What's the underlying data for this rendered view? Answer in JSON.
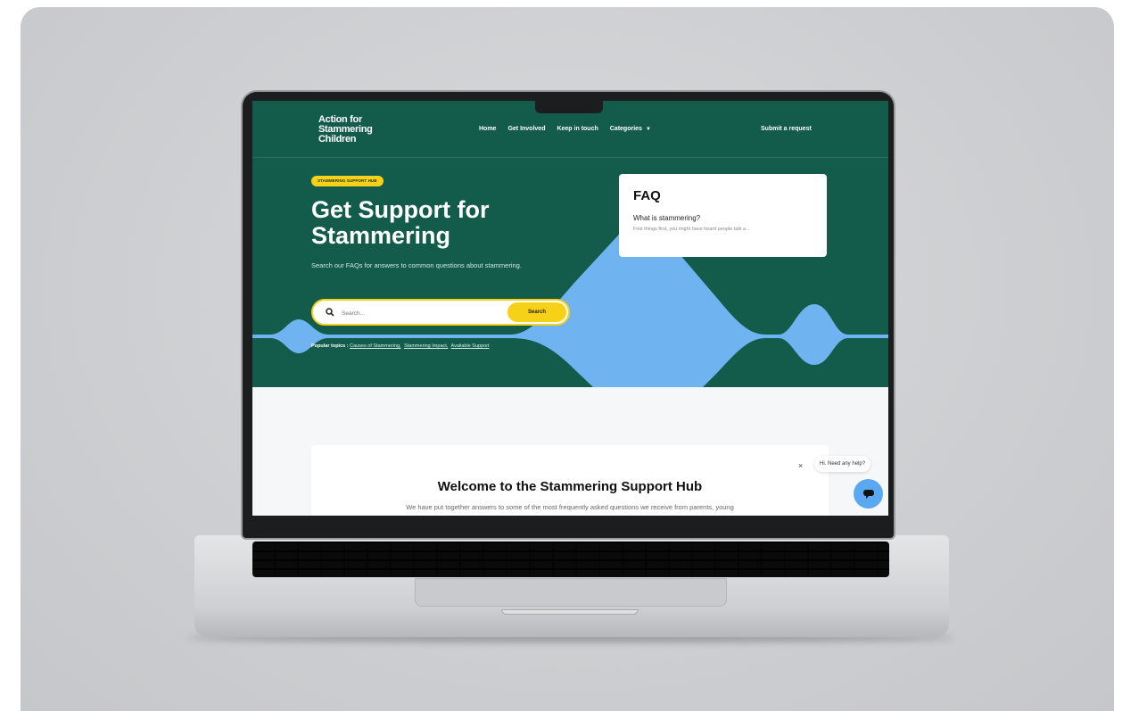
{
  "site": {
    "logo_lines": [
      "Action for",
      "Stammering",
      "Children"
    ]
  },
  "nav": {
    "items": [
      {
        "label": "Home"
      },
      {
        "label": "Get Involved"
      },
      {
        "label": "Keep in touch"
      },
      {
        "label": "Categories"
      }
    ],
    "submit_request": "Submit a request"
  },
  "hero": {
    "badge": "STAMMERING SUPPORT HUB",
    "title_line1": "Get Support for",
    "title_line2": "Stammering",
    "subtitle": "Search our FAQs for answers to common questions about stammering.",
    "search": {
      "placeholder": "Search...",
      "button": "Search"
    },
    "popular": {
      "label": "Popular topics :",
      "topics": [
        "Causes of Stammering,",
        "Stammering Impact,",
        "Available Support"
      ]
    }
  },
  "faq_card": {
    "title": "FAQ",
    "question": "What is stammering?",
    "answer_preview": "First things first, you might have heard people talk a..."
  },
  "welcome": {
    "title": "Welcome to the Stammering Support Hub",
    "text": "We have put together answers to some of the most frequently asked questions we receive from parents, young"
  },
  "chat": {
    "prompt": "Hi. Need any help?",
    "close_glyph": "×"
  },
  "colors": {
    "brand_green": "#135c4b",
    "accent_yellow": "#f7d117",
    "wave_blue": "#6fb3f0",
    "chat_blue": "#5aa7f2"
  }
}
